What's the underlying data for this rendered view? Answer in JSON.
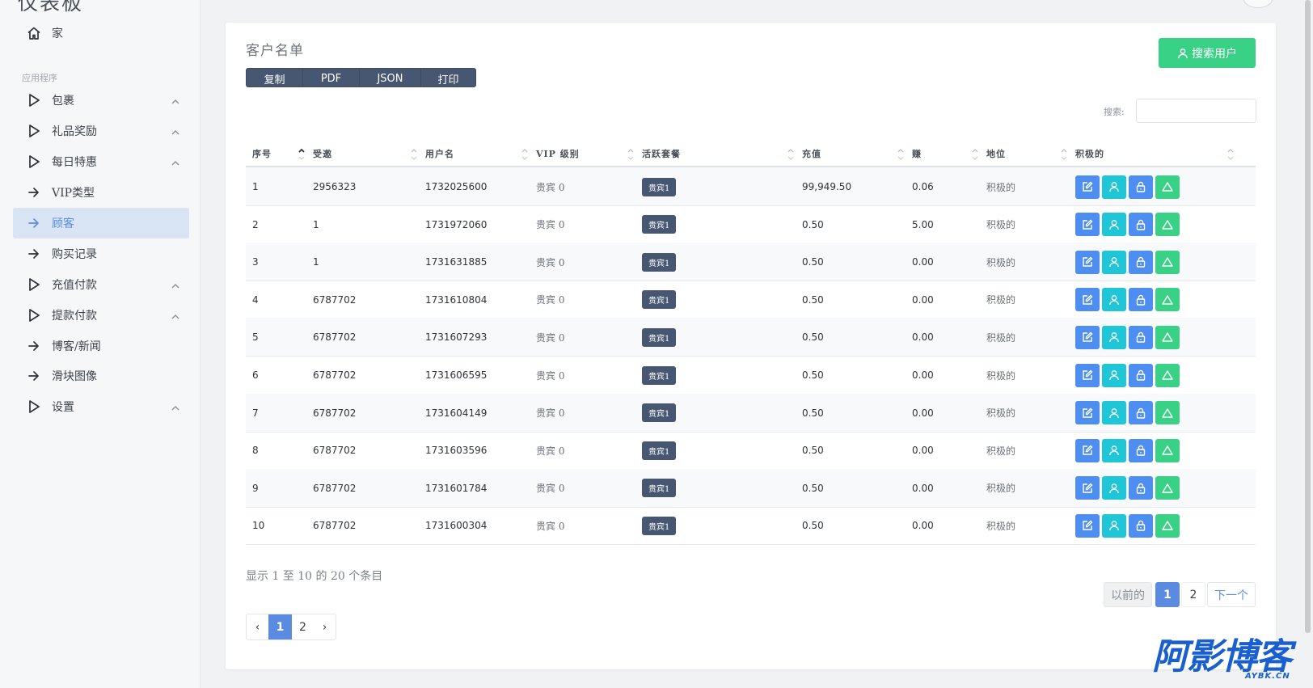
{
  "brand": "仪表板",
  "sidebar": {
    "section_label": "应用程序",
    "items": [
      {
        "label": "家",
        "icon": "home-icon"
      },
      {
        "label": "包裹",
        "icon": "play-icon"
      },
      {
        "label": "礼品奖励",
        "icon": "play-icon"
      },
      {
        "label": "每日特惠",
        "icon": "play-icon"
      },
      {
        "label": "VIP类型",
        "icon": "arrow-right-icon"
      },
      {
        "label": "顾客",
        "icon": "arrow-right-icon",
        "active": true
      },
      {
        "label": "购买记录",
        "icon": "arrow-right-icon"
      },
      {
        "label": "充值付款",
        "icon": "play-icon"
      },
      {
        "label": "提款付款",
        "icon": "play-icon"
      },
      {
        "label": "博客/新闻",
        "icon": "arrow-right-icon"
      },
      {
        "label": "滑块图像",
        "icon": "arrow-right-icon"
      },
      {
        "label": "设置",
        "icon": "play-icon"
      }
    ]
  },
  "card": {
    "title": "客户名单",
    "export_buttons": [
      "复制",
      "PDF",
      "JSON",
      "打印"
    ],
    "search_user_label": "搜索用户",
    "search_label": "搜索:",
    "search_value": ""
  },
  "table": {
    "columns": [
      "序号",
      "受邀",
      "用户名",
      "VIP 级别",
      "活跃套餐",
      "充值",
      "赚",
      "地位",
      "积极的"
    ],
    "rows": [
      [
        "1",
        "2956323",
        "1732025600",
        "贵宾 0",
        "贵宾1",
        "99,949.50",
        "0.06",
        "积极的"
      ],
      [
        "2",
        "1",
        "1731972060",
        "贵宾 0",
        "贵宾1",
        "0.50",
        "5.00",
        "积极的"
      ],
      [
        "3",
        "1",
        "1731631885",
        "贵宾 0",
        "贵宾1",
        "0.50",
        "0.00",
        "积极的"
      ],
      [
        "4",
        "6787702",
        "1731610804",
        "贵宾 0",
        "贵宾1",
        "0.50",
        "0.00",
        "积极的"
      ],
      [
        "5",
        "6787702",
        "1731607293",
        "贵宾 0",
        "贵宾1",
        "0.50",
        "0.00",
        "积极的"
      ],
      [
        "6",
        "6787702",
        "1731606595",
        "贵宾 0",
        "贵宾1",
        "0.50",
        "0.00",
        "积极的"
      ],
      [
        "7",
        "6787702",
        "1731604149",
        "贵宾 0",
        "贵宾1",
        "0.50",
        "0.00",
        "积极的"
      ],
      [
        "8",
        "6787702",
        "1731603596",
        "贵宾 0",
        "贵宾1",
        "0.50",
        "0.00",
        "积极的"
      ],
      [
        "9",
        "6787702",
        "1731601784",
        "贵宾 0",
        "贵宾1",
        "0.50",
        "0.00",
        "积极的"
      ],
      [
        "10",
        "6787702",
        "1731600304",
        "贵宾 0",
        "贵宾1",
        "0.50",
        "0.00",
        "积极的"
      ]
    ],
    "action_icons": [
      "edit-icon",
      "user-icon",
      "lock-icon",
      "triangle-up-icon"
    ]
  },
  "footer": {
    "info": "显示 1 至 10 的 20 个条目",
    "prev_label": "以前的",
    "next_label": "下一个",
    "pages": [
      "1",
      "2"
    ],
    "current_page": "1",
    "left_prev": "‹",
    "left_next": "›"
  },
  "watermark": {
    "main": "阿影博客",
    "sub": "AYBK.CN"
  },
  "colors": {
    "accent": "#5b8be0",
    "green": "#39d186",
    "cyan": "#1fc6d8",
    "blue": "#4e8ef0",
    "dark_badge": "#475771"
  }
}
